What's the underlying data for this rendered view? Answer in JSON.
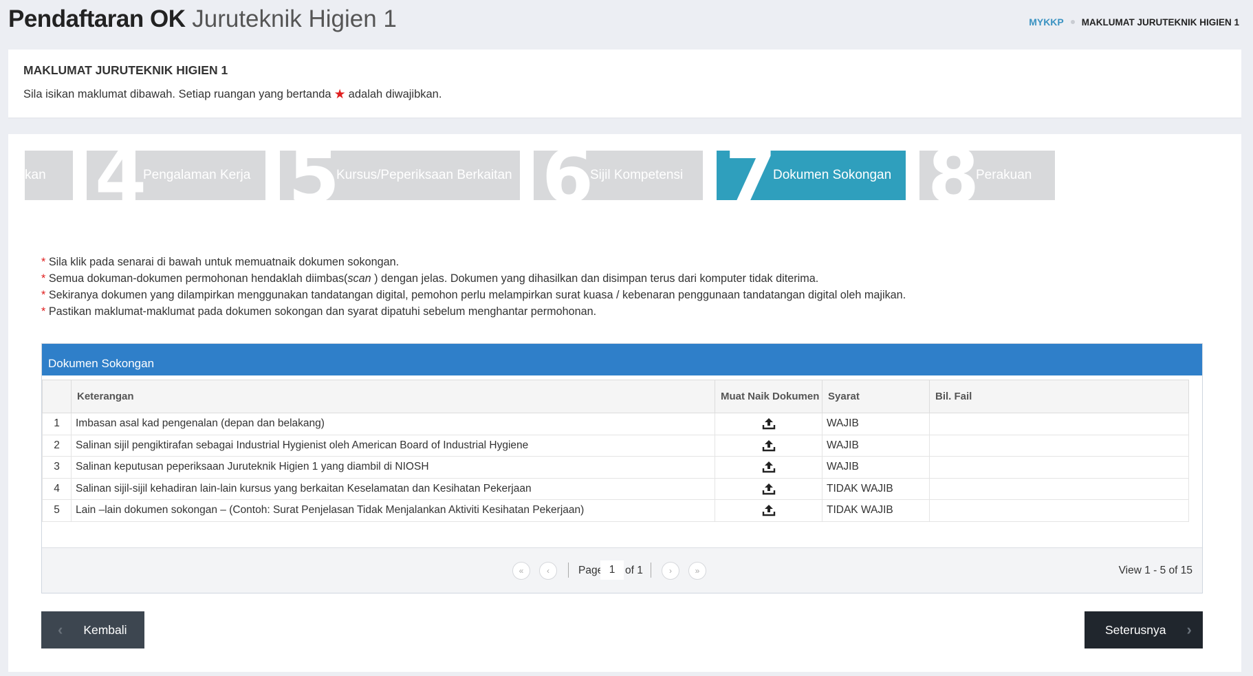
{
  "header": {
    "title_bold": "Pendaftaran OK",
    "title_light": "Juruteknik Higien 1",
    "breadcrumb": [
      "MYKKP",
      "MAKLUMAT JURUTEKNIK HIGIEN 1"
    ]
  },
  "info": {
    "title": "MAKLUMAT JURUTEKNIK HIGIEN 1",
    "text_before": "Sila isikan maklumat dibawah. Setiap ruangan yang bertanda",
    "text_after": "adalah diwajibkan."
  },
  "steps": [
    {
      "num": "",
      "label": "kan"
    },
    {
      "num": "4",
      "label": "Pengalaman Kerja"
    },
    {
      "num": "5",
      "label": "Kursus/Peperiksaan Berkaitan"
    },
    {
      "num": "6",
      "label": "Sijil Kompetensi"
    },
    {
      "num": "7",
      "label": "Dokumen Sokongan",
      "active": true
    },
    {
      "num": "8",
      "label": "Perakuan"
    }
  ],
  "notes": [
    {
      "text": "Sila klik pada senarai di bawah untuk memuatnaik dokumen sokongan."
    },
    {
      "pre": "Semua dokuman-dokumen permohonan hendaklah diimbas(",
      "em": "scan",
      "post": " ) dengan jelas. Dokumen yang dihasilkan dan disimpan terus dari komputer tidak diterima."
    },
    {
      "text": "Sekiranya dokumen yang dilampirkan menggunakan tandatangan digital, pemohon perlu melampirkan surat kuasa / kebenaran penggunaan tandatangan digital oleh majikan."
    },
    {
      "text": "Pastikan maklumat-maklumat pada dokumen sokongan dan syarat dipatuhi sebelum menghantar permohonan."
    }
  ],
  "grid": {
    "caption": "Dokumen Sokongan",
    "columns": [
      "",
      "Keterangan",
      "Muat Naik Dokumen",
      "Syarat",
      "Bil. Fail"
    ],
    "rows": [
      {
        "no": "1",
        "desc": "Imbasan asal kad pengenalan (depan dan belakang)",
        "syarat": "WAJIB",
        "bil": ""
      },
      {
        "no": "2",
        "desc": "Salinan sijil pengiktirafan sebagai Industrial Hygienist oleh American Board of Industrial Hygiene",
        "syarat": "WAJIB",
        "bil": ""
      },
      {
        "no": "3",
        "desc": "Salinan keputusan peperiksaan Juruteknik Higien 1 yang diambil di NIOSH",
        "syarat": "WAJIB",
        "bil": ""
      },
      {
        "no": "4",
        "desc": "Salinan sijil-sijil kehadiran lain-lain kursus yang berkaitan Keselamatan dan Kesihatan Pekerjaan",
        "syarat": "TIDAK WAJIB",
        "bil": ""
      },
      {
        "no": "5",
        "desc": "Lain –lain dokumen sokongan – (Contoh:  Surat Penjelasan Tidak Menjalankan Aktiviti Kesihatan Pekerjaan)",
        "syarat": "TIDAK WAJIB",
        "bil": ""
      }
    ],
    "pager": {
      "page_label": "Page",
      "page_value": "1",
      "of_label": "of 1",
      "view_text": "View 1 - 5 of 15",
      "icons": [
        "first-page-icon",
        "prev-page-icon",
        "next-page-icon",
        "last-page-icon"
      ]
    }
  },
  "buttons": {
    "back": "Kembali",
    "next": "Seterusnya"
  },
  "colors": {
    "accent": "#2f9fbd",
    "grid_header": "#2f7fc9",
    "required": "#e02020"
  }
}
